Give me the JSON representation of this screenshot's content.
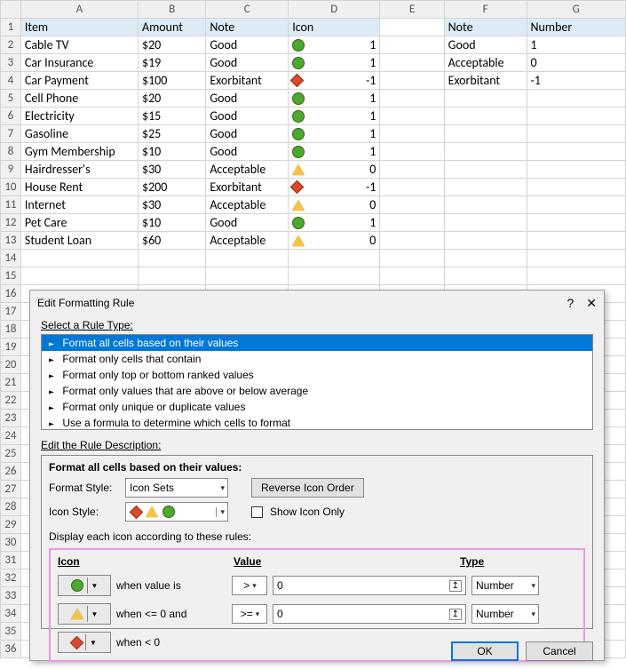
{
  "cols": [
    "A",
    "B",
    "C",
    "D",
    "E",
    "F",
    "G"
  ],
  "rows": [
    "1",
    "2",
    "3",
    "4",
    "5",
    "6",
    "7",
    "8",
    "9",
    "10",
    "11",
    "12",
    "13",
    "14",
    "15",
    "16",
    "17",
    "18",
    "19",
    "20",
    "21",
    "22",
    "23",
    "24",
    "25",
    "26",
    "27",
    "28",
    "29",
    "30",
    "31",
    "32",
    "33",
    "34",
    "35",
    "36"
  ],
  "headers": {
    "A": "Item",
    "B": "Amount",
    "C": "Note",
    "D": "Icon",
    "F": "Note",
    "G": "Number"
  },
  "data": [
    {
      "item": "Cable TV",
      "amount": "$20",
      "note": "Good",
      "icon": "green",
      "val": "1"
    },
    {
      "item": "Car Insurance",
      "amount": "$19",
      "note": "Good",
      "icon": "green",
      "val": "1"
    },
    {
      "item": "Car Payment",
      "amount": "$100",
      "note": "Exorbitant",
      "icon": "red",
      "val": "-1"
    },
    {
      "item": "Cell Phone",
      "amount": "$20",
      "note": "Good",
      "icon": "green",
      "val": "1"
    },
    {
      "item": "Electricity",
      "amount": "$15",
      "note": "Good",
      "icon": "green",
      "val": "1"
    },
    {
      "item": "Gasoline",
      "amount": "$25",
      "note": "Good",
      "icon": "green",
      "val": "1"
    },
    {
      "item": "Gym Membership",
      "amount": "$10",
      "note": "Good",
      "icon": "green",
      "val": "1"
    },
    {
      "item": "Hairdresser's",
      "amount": "$30",
      "note": "Acceptable",
      "icon": "yellow",
      "val": "0"
    },
    {
      "item": "House Rent",
      "amount": "$200",
      "note": "Exorbitant",
      "icon": "red",
      "val": "-1"
    },
    {
      "item": "Internet",
      "amount": "$30",
      "note": "Acceptable",
      "icon": "yellow",
      "val": "0"
    },
    {
      "item": "Pet Care",
      "amount": "$10",
      "note": "Good",
      "icon": "green",
      "val": "1"
    },
    {
      "item": "Student Loan",
      "amount": "$60",
      "note": "Acceptable",
      "icon": "yellow",
      "val": "0"
    }
  ],
  "lookup": [
    {
      "note": "Good",
      "num": "1"
    },
    {
      "note": "Acceptable",
      "num": "0"
    },
    {
      "note": "Exorbitant",
      "num": "-1"
    }
  ],
  "dialog": {
    "title": "Edit Formatting Rule",
    "help": "?",
    "close": "✕",
    "select_label": "Select a Rule Type:",
    "rule_types": [
      "Format all cells based on their values",
      "Format only cells that contain",
      "Format only top or bottom ranked values",
      "Format only values that are above or below average",
      "Format only unique or duplicate values",
      "Use a formula to determine which cells to format"
    ],
    "edit_label": "Edit the Rule Description:",
    "format_heading": "Format all cells based on their values:",
    "format_style_lbl": "Format Style:",
    "format_style_val": "Icon Sets",
    "reverse_btn": "Reverse Icon Order",
    "icon_style_lbl": "Icon Style:",
    "show_icon_only": "Show Icon Only",
    "display_lbl": "Display each icon according to these rules:",
    "cols": {
      "icon": "Icon",
      "value": "Value",
      "type": "Type"
    },
    "rules": [
      {
        "icon": "green",
        "when": "when value is",
        "op": ">",
        "val": "0",
        "type": "Number"
      },
      {
        "icon": "yellow",
        "when": "when <= 0 and",
        "op": ">=",
        "val": "0",
        "type": "Number"
      },
      {
        "icon": "red",
        "when": "when < 0",
        "op": "",
        "val": "",
        "type": ""
      }
    ],
    "ok": "OK",
    "cancel": "Cancel"
  }
}
